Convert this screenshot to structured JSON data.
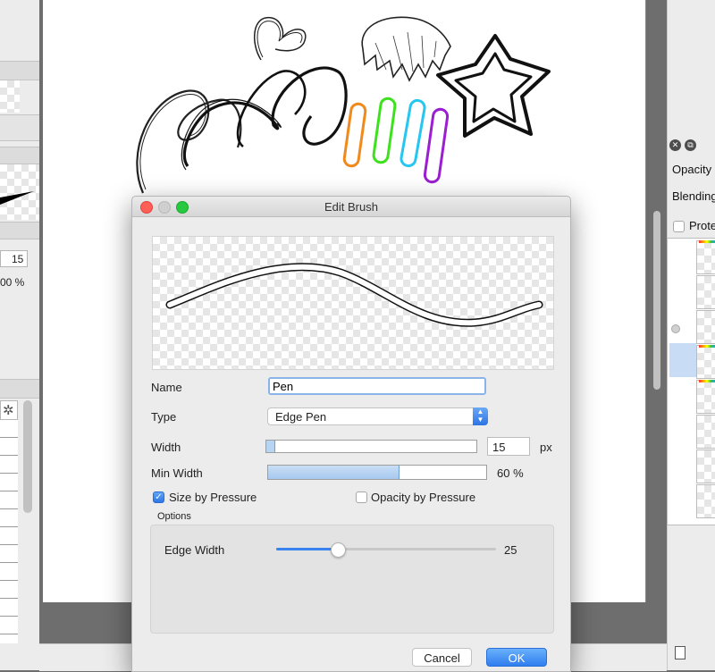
{
  "left_panel": {
    "size_value": "15",
    "opacity_value": "00 %"
  },
  "right_panel": {
    "opacity_label": "Opacity",
    "blending_label": "Blending",
    "protect_label": "Prote"
  },
  "dialog": {
    "title": "Edit Brush",
    "name_label": "Name",
    "name_value": "Pen",
    "type_label": "Type",
    "type_value": "Edge Pen",
    "width_label": "Width",
    "width_value": "15",
    "width_unit": "px",
    "width_fraction": 0.04,
    "min_width_label": "Min Width",
    "min_width_value": "60 %",
    "min_width_fraction": 0.6,
    "size_by_pressure_label": "Size by Pressure",
    "size_by_pressure_checked": true,
    "opacity_by_pressure_label": "Opacity by Pressure",
    "opacity_by_pressure_checked": false,
    "options_label": "Options",
    "edge_width_label": "Edge Width",
    "edge_width_value": "25",
    "edge_width_fraction": 0.28,
    "cancel_label": "Cancel",
    "ok_label": "OK"
  },
  "colors": {
    "accent": "#2f7ef0",
    "close_button": "#ff5f57",
    "minimize_button": "#cfcfcf",
    "zoom_button": "#28c840",
    "stroke_orange": "#f08a1c",
    "stroke_green": "#3fe11e",
    "stroke_cyan": "#25c6f0",
    "stroke_purple": "#9b1fd1"
  }
}
